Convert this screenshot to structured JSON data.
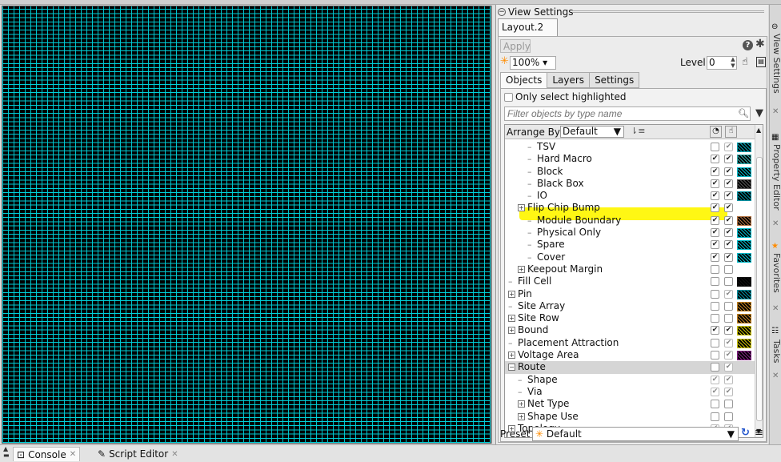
{
  "panel": {
    "title": "View Settings",
    "layout_tab": "Layout.2",
    "apply_label": "Apply",
    "zoom_value": "100%",
    "level_label": "Level",
    "level_value": "0",
    "subtabs": [
      "Objects",
      "Layers",
      "Settings"
    ],
    "only_select_label": "Only select highlighted",
    "filter_placeholder": "Filter objects by type name",
    "arrange_label": "Arrange By",
    "arrange_value": "Default",
    "preset_label": "Preset",
    "preset_value": "Default"
  },
  "tree_rows": [
    {
      "label": "TSV",
      "indent": 2,
      "expandable": false,
      "c1": "",
      "c2": "✔",
      "c2dis": true,
      "swatch": "#00a0b0"
    },
    {
      "label": "Hard Macro",
      "indent": 2,
      "expandable": false,
      "c1": "✔",
      "c2": "✔",
      "swatch": "#3aa"
    },
    {
      "label": "Block",
      "indent": 2,
      "expandable": false,
      "c1": "✔",
      "c2": "✔",
      "swatch": "#00b8c8"
    },
    {
      "label": "Black Box",
      "indent": 2,
      "expandable": false,
      "c1": "✔",
      "c2": "✔",
      "swatch": "#555"
    },
    {
      "label": "IO",
      "indent": 2,
      "expandable": false,
      "c1": "✔",
      "c2": "✔",
      "swatch": "#0090a0"
    },
    {
      "label": "Flip Chip Bump",
      "indent": 1,
      "expandable": true,
      "c1": "✔",
      "c2": "✔",
      "swatch": ""
    },
    {
      "label": "Module Boundary",
      "indent": 2,
      "expandable": false,
      "c1": "✔",
      "c2": "✔",
      "swatch": "#b07040"
    },
    {
      "label": "Physical Only",
      "indent": 2,
      "expandable": false,
      "c1": "✔",
      "c2": "✔",
      "swatch": "#00b8c8"
    },
    {
      "label": "Spare",
      "indent": 2,
      "expandable": false,
      "c1": "✔",
      "c2": "✔",
      "swatch": "#00b8c8"
    },
    {
      "label": "Cover",
      "indent": 2,
      "expandable": false,
      "c1": "✔",
      "c2": "✔",
      "swatch": "#00b8c8"
    },
    {
      "label": "Keepout Margin",
      "indent": 1,
      "expandable": true,
      "c1": "",
      "c2": "",
      "swatch": ""
    },
    {
      "label": "Fill Cell",
      "indent": 0,
      "expandable": false,
      "c1": "",
      "c2": "",
      "swatch": "#111"
    },
    {
      "label": "Pin",
      "indent": 0,
      "expandable": true,
      "c1": "",
      "c2": "✔",
      "c2dis": true,
      "swatch": "#0090a0"
    },
    {
      "label": "Site Array",
      "indent": 0,
      "expandable": false,
      "c1": "",
      "c2": "",
      "swatch": "#c08020"
    },
    {
      "label": "Site Row",
      "indent": 0,
      "expandable": true,
      "c1": "",
      "c2": "",
      "swatch": "#c08020"
    },
    {
      "label": "Bound",
      "indent": 0,
      "expandable": true,
      "c1": "✔",
      "c2": "✔",
      "swatch": "#c8c000"
    },
    {
      "label": "Placement Attraction",
      "indent": 0,
      "expandable": false,
      "c1": "",
      "c2": "✔",
      "c2dis": true,
      "swatch": "#c8c000"
    },
    {
      "label": "Voltage Area",
      "indent": 0,
      "expandable": true,
      "c1": "",
      "c2": "✔",
      "c2dis": true,
      "swatch": "#802080"
    },
    {
      "label": "Route",
      "indent": 0,
      "expandable": true,
      "expanded": true,
      "c1": "",
      "c2": "✔",
      "c2dis": true,
      "swatch": "",
      "selected": true
    },
    {
      "label": "Shape",
      "indent": 1,
      "expandable": false,
      "c1": "✔",
      "c1dis": true,
      "c2": "✔",
      "c2dis": true,
      "swatch": ""
    },
    {
      "label": "Via",
      "indent": 1,
      "expandable": false,
      "c1": "✔",
      "c1dis": true,
      "c2": "✔",
      "c2dis": true,
      "swatch": ""
    },
    {
      "label": "Net Type",
      "indent": 1,
      "expandable": true,
      "c1": "",
      "c2": "",
      "swatch": ""
    },
    {
      "label": "Shape Use",
      "indent": 1,
      "expandable": true,
      "c1": "",
      "c2": "",
      "swatch": ""
    },
    {
      "label": "Topology",
      "indent": 0,
      "expandable": true,
      "c1": "✔",
      "c1dis": true,
      "c2": "✔",
      "c2dis": true,
      "swatch": ""
    }
  ],
  "dock": {
    "tabs": [
      "View Settings",
      "Property Editor",
      "Favorites",
      "Tasks"
    ]
  },
  "bottom": {
    "tabs": [
      "Console",
      "Script Editor"
    ]
  },
  "colors": {
    "canvas_grid": "#00d0d8",
    "highlight": "#fff600"
  }
}
